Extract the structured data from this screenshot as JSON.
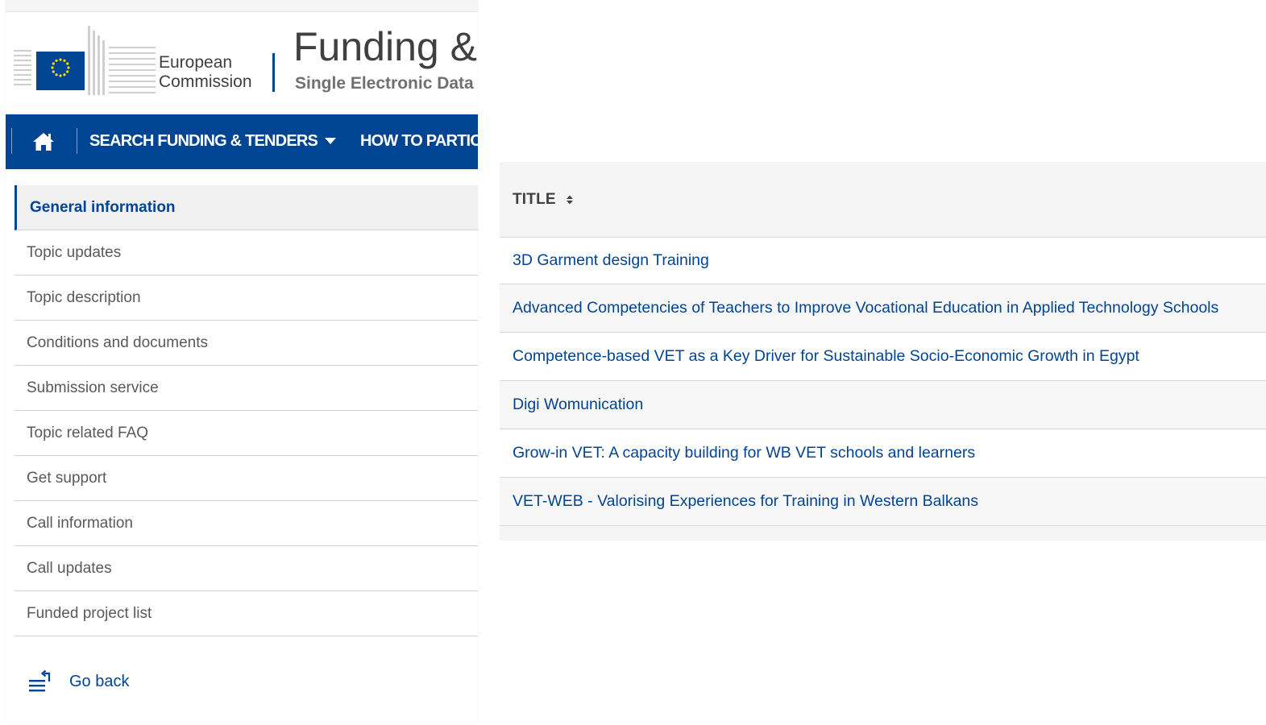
{
  "header": {
    "org_line1": "European",
    "org_line2": "Commission",
    "portal_title": "Funding &",
    "portal_subtitle": "Single Electronic Data"
  },
  "navbar": {
    "home_icon": "home-icon",
    "items": [
      {
        "label": "SEARCH FUNDING & TENDERS",
        "has_dropdown": true
      },
      {
        "label": "HOW TO PARTIC"
      }
    ]
  },
  "sidebar": {
    "items": [
      {
        "label": "General information",
        "active": true
      },
      {
        "label": "Topic updates"
      },
      {
        "label": "Topic description"
      },
      {
        "label": "Conditions and documents"
      },
      {
        "label": "Submission service"
      },
      {
        "label": "Topic related FAQ"
      },
      {
        "label": "Get support"
      },
      {
        "label": "Call information"
      },
      {
        "label": "Call updates"
      },
      {
        "label": "Funded project list"
      }
    ],
    "go_back": {
      "label": "Go back",
      "icon": "go-back-icon"
    }
  },
  "table": {
    "column_header": "TITLE",
    "sort_icon": "sort-icon",
    "rows": [
      "3D Garment design Training",
      "Advanced Competencies of Teachers to Improve Vocational Education in Applied Technology Schools",
      "Competence-based VET as a Key Driver for Sustainable Socio-Economic Growth in Egypt",
      "Digi Womunication",
      "Grow-in VET: A capacity building for WB VET schools and learners",
      "VET-WEB - Valorising Experiences for Training in Western Balkans"
    ]
  },
  "colors": {
    "brand_blue": "#004494",
    "eu_flag_blue": "#004494",
    "eu_star_yellow": "#ffdd00",
    "link": "#004494"
  }
}
